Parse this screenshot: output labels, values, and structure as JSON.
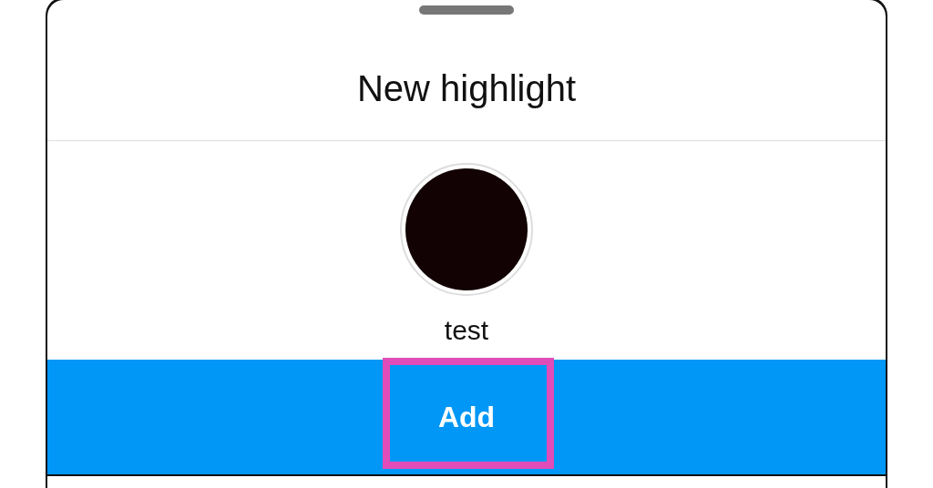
{
  "sheet": {
    "title": "New highlight"
  },
  "highlight": {
    "name": "test"
  },
  "buttons": [
    {
      "label": "Add",
      "highlighted": true
    }
  ]
}
